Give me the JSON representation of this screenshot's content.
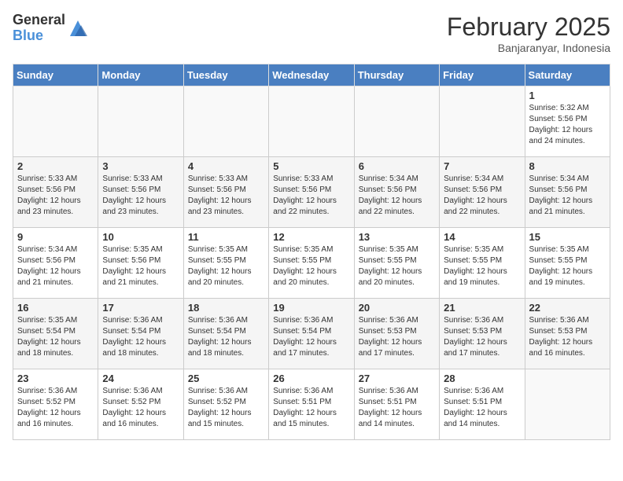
{
  "header": {
    "logo_general": "General",
    "logo_blue": "Blue",
    "month_title": "February 2025",
    "location": "Banjaranyar, Indonesia"
  },
  "days_of_week": [
    "Sunday",
    "Monday",
    "Tuesday",
    "Wednesday",
    "Thursday",
    "Friday",
    "Saturday"
  ],
  "weeks": [
    {
      "days": [
        {
          "num": "",
          "info": ""
        },
        {
          "num": "",
          "info": ""
        },
        {
          "num": "",
          "info": ""
        },
        {
          "num": "",
          "info": ""
        },
        {
          "num": "",
          "info": ""
        },
        {
          "num": "",
          "info": ""
        },
        {
          "num": "1",
          "info": "Sunrise: 5:32 AM\nSunset: 5:56 PM\nDaylight: 12 hours\nand 24 minutes."
        }
      ]
    },
    {
      "days": [
        {
          "num": "2",
          "info": "Sunrise: 5:33 AM\nSunset: 5:56 PM\nDaylight: 12 hours\nand 23 minutes."
        },
        {
          "num": "3",
          "info": "Sunrise: 5:33 AM\nSunset: 5:56 PM\nDaylight: 12 hours\nand 23 minutes."
        },
        {
          "num": "4",
          "info": "Sunrise: 5:33 AM\nSunset: 5:56 PM\nDaylight: 12 hours\nand 23 minutes."
        },
        {
          "num": "5",
          "info": "Sunrise: 5:33 AM\nSunset: 5:56 PM\nDaylight: 12 hours\nand 22 minutes."
        },
        {
          "num": "6",
          "info": "Sunrise: 5:34 AM\nSunset: 5:56 PM\nDaylight: 12 hours\nand 22 minutes."
        },
        {
          "num": "7",
          "info": "Sunrise: 5:34 AM\nSunset: 5:56 PM\nDaylight: 12 hours\nand 22 minutes."
        },
        {
          "num": "8",
          "info": "Sunrise: 5:34 AM\nSunset: 5:56 PM\nDaylight: 12 hours\nand 21 minutes."
        }
      ]
    },
    {
      "days": [
        {
          "num": "9",
          "info": "Sunrise: 5:34 AM\nSunset: 5:56 PM\nDaylight: 12 hours\nand 21 minutes."
        },
        {
          "num": "10",
          "info": "Sunrise: 5:35 AM\nSunset: 5:56 PM\nDaylight: 12 hours\nand 21 minutes."
        },
        {
          "num": "11",
          "info": "Sunrise: 5:35 AM\nSunset: 5:55 PM\nDaylight: 12 hours\nand 20 minutes."
        },
        {
          "num": "12",
          "info": "Sunrise: 5:35 AM\nSunset: 5:55 PM\nDaylight: 12 hours\nand 20 minutes."
        },
        {
          "num": "13",
          "info": "Sunrise: 5:35 AM\nSunset: 5:55 PM\nDaylight: 12 hours\nand 20 minutes."
        },
        {
          "num": "14",
          "info": "Sunrise: 5:35 AM\nSunset: 5:55 PM\nDaylight: 12 hours\nand 19 minutes."
        },
        {
          "num": "15",
          "info": "Sunrise: 5:35 AM\nSunset: 5:55 PM\nDaylight: 12 hours\nand 19 minutes."
        }
      ]
    },
    {
      "days": [
        {
          "num": "16",
          "info": "Sunrise: 5:35 AM\nSunset: 5:54 PM\nDaylight: 12 hours\nand 18 minutes."
        },
        {
          "num": "17",
          "info": "Sunrise: 5:36 AM\nSunset: 5:54 PM\nDaylight: 12 hours\nand 18 minutes."
        },
        {
          "num": "18",
          "info": "Sunrise: 5:36 AM\nSunset: 5:54 PM\nDaylight: 12 hours\nand 18 minutes."
        },
        {
          "num": "19",
          "info": "Sunrise: 5:36 AM\nSunset: 5:54 PM\nDaylight: 12 hours\nand 17 minutes."
        },
        {
          "num": "20",
          "info": "Sunrise: 5:36 AM\nSunset: 5:53 PM\nDaylight: 12 hours\nand 17 minutes."
        },
        {
          "num": "21",
          "info": "Sunrise: 5:36 AM\nSunset: 5:53 PM\nDaylight: 12 hours\nand 17 minutes."
        },
        {
          "num": "22",
          "info": "Sunrise: 5:36 AM\nSunset: 5:53 PM\nDaylight: 12 hours\nand 16 minutes."
        }
      ]
    },
    {
      "days": [
        {
          "num": "23",
          "info": "Sunrise: 5:36 AM\nSunset: 5:52 PM\nDaylight: 12 hours\nand 16 minutes."
        },
        {
          "num": "24",
          "info": "Sunrise: 5:36 AM\nSunset: 5:52 PM\nDaylight: 12 hours\nand 16 minutes."
        },
        {
          "num": "25",
          "info": "Sunrise: 5:36 AM\nSunset: 5:52 PM\nDaylight: 12 hours\nand 15 minutes."
        },
        {
          "num": "26",
          "info": "Sunrise: 5:36 AM\nSunset: 5:51 PM\nDaylight: 12 hours\nand 15 minutes."
        },
        {
          "num": "27",
          "info": "Sunrise: 5:36 AM\nSunset: 5:51 PM\nDaylight: 12 hours\nand 14 minutes."
        },
        {
          "num": "28",
          "info": "Sunrise: 5:36 AM\nSunset: 5:51 PM\nDaylight: 12 hours\nand 14 minutes."
        },
        {
          "num": "",
          "info": ""
        }
      ]
    }
  ]
}
